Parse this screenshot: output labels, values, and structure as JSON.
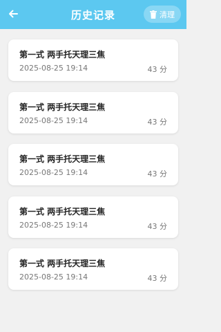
{
  "header": {
    "title": "历史记录",
    "clear_label": "清理",
    "back_icon": "arrow-left-icon",
    "clear_icon": "trash-icon",
    "background": "#5cc8f0"
  },
  "records": [
    {
      "title": "第一式 两手托天理三焦",
      "time": "2025-08-25 19:14",
      "score": "43 分"
    },
    {
      "title": "第一式 两手托天理三焦",
      "time": "2025-08-25 19:14",
      "score": "43 分"
    },
    {
      "title": "第一式 两手托天理三焦",
      "time": "2025-08-25 19:14",
      "score": "43 分"
    },
    {
      "title": "第一式 两手托天理三焦",
      "time": "2025-08-25 19:14",
      "score": "43 分"
    },
    {
      "title": "第一式 两手托天理三焦",
      "time": "2025-08-25 19:14",
      "score": "43 分"
    }
  ]
}
